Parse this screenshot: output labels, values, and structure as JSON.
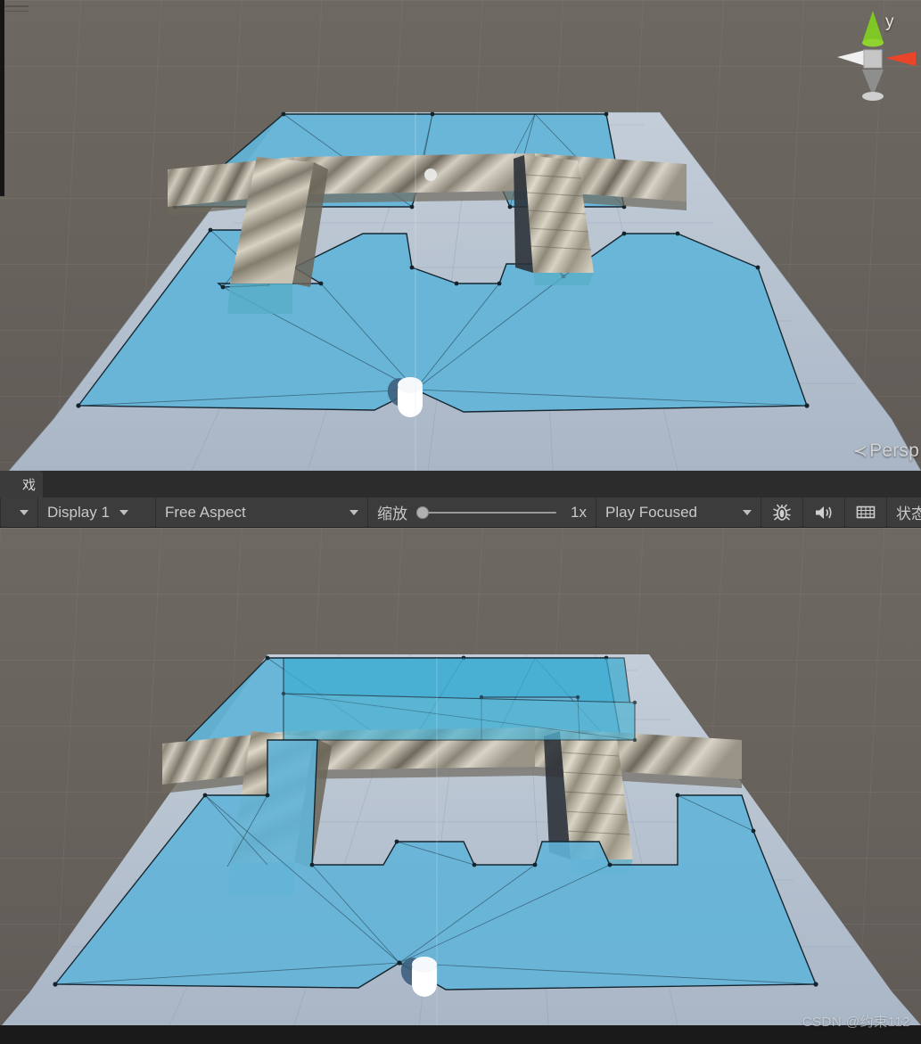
{
  "window": {
    "app": "Unity Editor",
    "view_type": "Scene / Game split view"
  },
  "scene_top": {
    "name": "scene-view-upper",
    "gizmo": {
      "y_axis_label": "y",
      "projection_label": "Persp",
      "projection_arrow": "≺",
      "x_axis_color": "#e8452a",
      "y_axis_color": "#7fc724",
      "z_axis_color": "#3b7de0",
      "center_cube_color": "#c6c6c6"
    },
    "background_color": "#6b6560",
    "floor_color": "#b3bfcc",
    "navmesh_color": "#62b4d8",
    "navmesh_edge_color": "#1b2b33",
    "wall_color": "#b9b3a4",
    "agent_label": "player-capsule",
    "agent_color": "#ffffff"
  },
  "scene_bottom": {
    "name": "scene-view-lower",
    "background_color": "#6b6560",
    "floor_color": "#b3bfcc",
    "navmesh_color": "#62b4d8",
    "navmesh_overlay_color": "#4fb4cf",
    "navmesh_edge_color": "#1b2b33",
    "wall_color": "#b9b3a4",
    "agent_label": "player-capsule",
    "agent_color": "#ffffff"
  },
  "toolbar": {
    "tab_label": "戏",
    "left_dropdown_label": "",
    "display_label": "Display 1",
    "aspect_label": "Free Aspect",
    "scale_label": "缩放",
    "scale_value": "1x",
    "scale_slider_percent": 0,
    "play_mode_label": "Play Focused",
    "debug_icon": "bug-icon",
    "mute_icon": "speaker-icon",
    "gizmos_icon": "grid-icon",
    "stats_label": "状态"
  },
  "watermark": {
    "text": "CSDN @约束112"
  }
}
